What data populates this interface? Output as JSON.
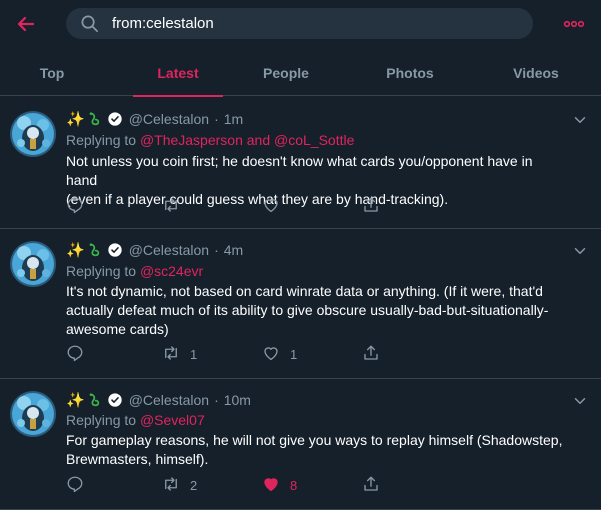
{
  "search": {
    "value": "from:celestalon"
  },
  "tabs": [
    {
      "label": "Top",
      "active": false
    },
    {
      "label": "Latest",
      "active": true
    },
    {
      "label": "People",
      "active": false
    },
    {
      "label": "Photos",
      "active": false
    },
    {
      "label": "Videos",
      "active": false
    }
  ],
  "colors": {
    "accent": "#e0245e",
    "background": "#15202b",
    "muted": "#8899a6",
    "divider": "#38444d"
  },
  "tweets": [
    {
      "name_emoji": "✨",
      "handle": "@Celestalon",
      "time": "1m",
      "replying_prefix": "Replying to",
      "replying_to": "@TheJasperson and @coL_Sottle",
      "text_lines": [
        "Not unless you coin first; he doesn't know what cards you/opponent have in hand",
        "(even if a player could guess what they are by hand-tracking)."
      ],
      "reply_count": "",
      "retweet_count": "",
      "like_count": "",
      "liked": false
    },
    {
      "name_emoji": "✨",
      "handle": "@Celestalon",
      "time": "4m",
      "replying_prefix": "Replying to",
      "replying_to": "@sc24evr",
      "text_lines": [
        "It's not dynamic, not based on card winrate data or anything. (If it were, that'd",
        "actually defeat much of its ability to give obscure usually-bad-but-situationally-",
        "awesome cards)"
      ],
      "reply_count": "",
      "retweet_count": "1",
      "like_count": "1",
      "liked": false
    },
    {
      "name_emoji": "✨",
      "handle": "@Celestalon",
      "time": "10m",
      "replying_prefix": "Replying to",
      "replying_to": "@Sevel07",
      "text_lines": [
        "For gameplay reasons, he will not give you ways to replay himself (Shadowstep,",
        "Brewmasters, himself)."
      ],
      "reply_count": "",
      "retweet_count": "2",
      "like_count": "8",
      "liked": true
    }
  ]
}
